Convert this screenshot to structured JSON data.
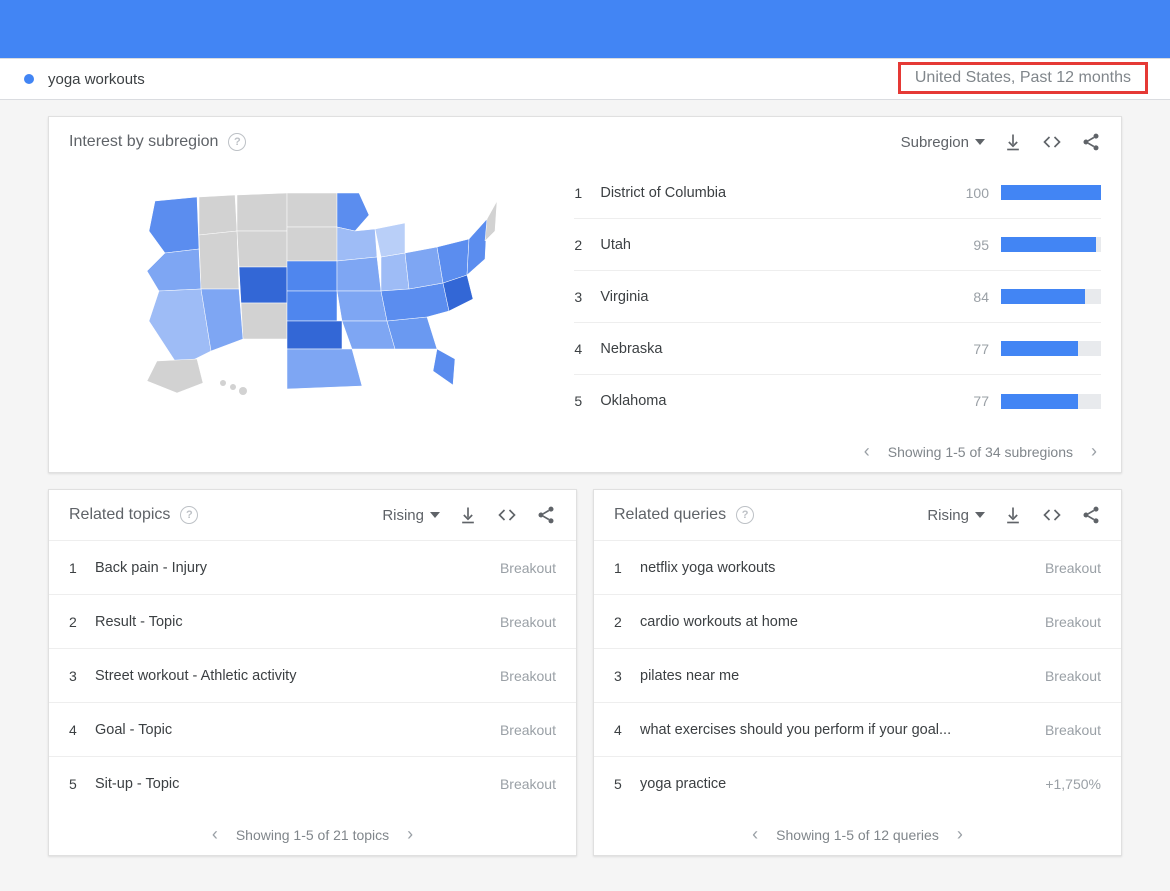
{
  "term_bar": {
    "term": "yoga workouts",
    "filters_text": "United States, Past 12 months"
  },
  "interest_card": {
    "title": "Interest by subregion",
    "dropdown_label": "Subregion",
    "rows": [
      {
        "rank": "1",
        "name": "District of Columbia",
        "value": "100",
        "pct": 100
      },
      {
        "rank": "2",
        "name": "Utah",
        "value": "95",
        "pct": 95
      },
      {
        "rank": "3",
        "name": "Virginia",
        "value": "84",
        "pct": 84
      },
      {
        "rank": "4",
        "name": "Nebraska",
        "value": "77",
        "pct": 77
      },
      {
        "rank": "5",
        "name": "Oklahoma",
        "value": "77",
        "pct": 77
      }
    ],
    "pager_text": "Showing 1-5 of 34 subregions"
  },
  "related_topics": {
    "title": "Related topics",
    "dropdown_label": "Rising",
    "rows": [
      {
        "rank": "1",
        "name": "Back pain - Injury",
        "metric": "Breakout"
      },
      {
        "rank": "2",
        "name": "Result - Topic",
        "metric": "Breakout"
      },
      {
        "rank": "3",
        "name": "Street workout - Athletic activity",
        "metric": "Breakout"
      },
      {
        "rank": "4",
        "name": "Goal - Topic",
        "metric": "Breakout"
      },
      {
        "rank": "5",
        "name": "Sit-up - Topic",
        "metric": "Breakout"
      }
    ],
    "pager_text": "Showing 1-5 of 21 topics"
  },
  "related_queries": {
    "title": "Related queries",
    "dropdown_label": "Rising",
    "rows": [
      {
        "rank": "1",
        "name": "netflix yoga workouts",
        "metric": "Breakout"
      },
      {
        "rank": "2",
        "name": "cardio workouts at home",
        "metric": "Breakout"
      },
      {
        "rank": "3",
        "name": "pilates near me",
        "metric": "Breakout"
      },
      {
        "rank": "4",
        "name": "what exercises should you perform if your goal...",
        "metric": "Breakout"
      },
      {
        "rank": "5",
        "name": "yoga practice",
        "metric": "+1,750%"
      }
    ],
    "pager_text": "Showing 1-5 of 12 queries"
  },
  "chart_data": {
    "type": "bar",
    "title": "Interest by subregion",
    "categories": [
      "District of Columbia",
      "Utah",
      "Virginia",
      "Nebraska",
      "Oklahoma"
    ],
    "values": [
      100,
      95,
      84,
      77,
      77
    ],
    "ylim": [
      0,
      100
    ],
    "xlabel": "",
    "ylabel": ""
  }
}
